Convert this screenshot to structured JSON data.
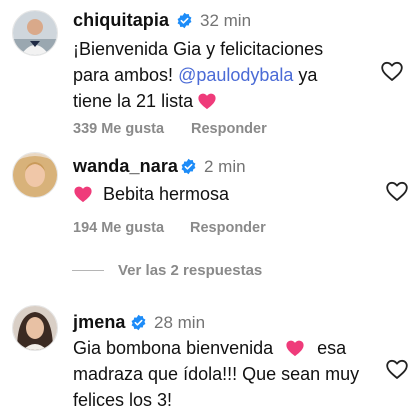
{
  "comments": [
    {
      "username": "chiquitapia",
      "time": "32 min",
      "text_1": "¡Bienvenida Gia y felicitaciones",
      "text_2a": "para ambos! ",
      "mention": "@paulodybala",
      "text_2b": " ya",
      "text_3": "tiene la 21 lista",
      "likes": "339 Me gusta",
      "reply_label": "Responder"
    },
    {
      "username": "wanda_nara",
      "time": "2 min",
      "text": "Bebita hermosa",
      "likes": "194 Me gusta",
      "reply_label": "Responder"
    },
    {
      "username": "jmena",
      "time": "28 min",
      "text_1a": "Gia bombona bienvenida",
      "text_1b": "esa",
      "text_2": "madraza que ídola!!! Que sean muy",
      "text_3": "felices los 3!"
    }
  ],
  "view_replies": "Ver las 2 respuestas",
  "icons": {
    "verified": "verified-badge-icon",
    "heart": "heart-outline-icon",
    "emoji_heart": "pink-heart-emoji"
  },
  "colors": {
    "verified": "#1d8cf8",
    "mention": "#4b6bd6",
    "muted": "#8a8a8a",
    "emoji_heart": "#ef3b7a"
  }
}
